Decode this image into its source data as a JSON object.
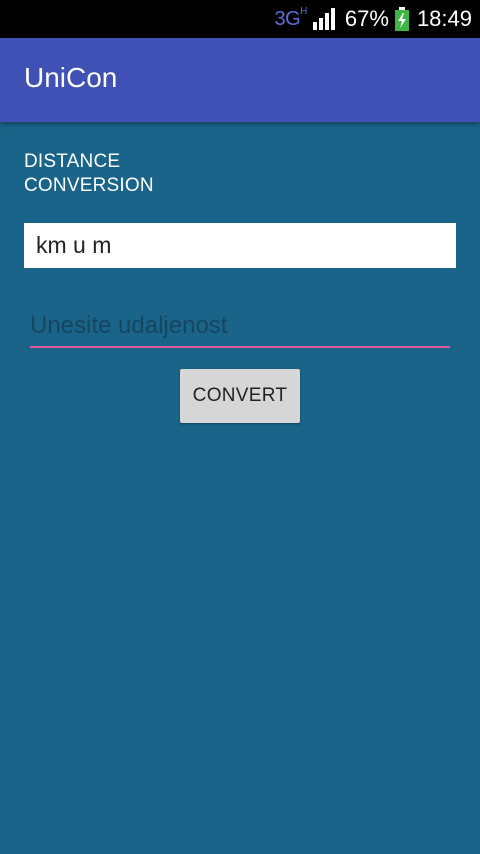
{
  "status_bar": {
    "network": "3G",
    "network_sub": "H",
    "battery_percent": "67%",
    "time": "18:49",
    "signal_icon": "signal-bars-icon",
    "battery_icon": "battery-charging-icon"
  },
  "app_bar": {
    "title": "UniCon"
  },
  "main": {
    "section_label": "DISTANCE CONVERSION",
    "unit_spinner": {
      "selected": "km u m"
    },
    "distance_input": {
      "value": "",
      "placeholder": "Unesite udaljenost"
    },
    "convert_button_label": "CONVERT"
  },
  "colors": {
    "background": "#1a6489",
    "app_bar": "#3f51b5",
    "input_underline": "#e05a9a",
    "button": "#d6d6d6"
  }
}
